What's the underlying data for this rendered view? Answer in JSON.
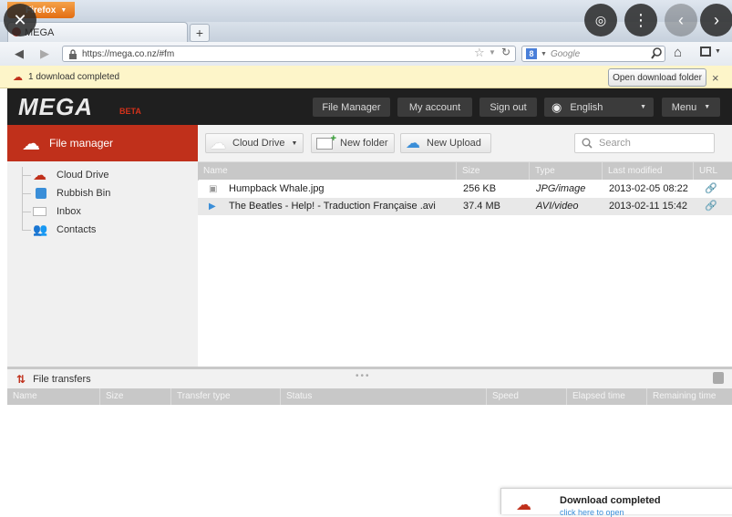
{
  "browser": {
    "app_button": "Firefox",
    "tab_title": "MEGA",
    "new_tab": "+",
    "url": "https://mega.co.nz/#fm",
    "search_engine_placeholder": "Google"
  },
  "notification": {
    "text": "1 download completed",
    "button": "Open download folder",
    "close": "×"
  },
  "mega_header": {
    "logo": "MEGA",
    "beta": "BETA",
    "buttons": [
      "File Manager",
      "My account",
      "Sign out"
    ],
    "language": "English",
    "menu": "Menu"
  },
  "sidebar": {
    "title": "File manager",
    "items": [
      "Cloud Drive",
      "Rubbish Bin",
      "Inbox",
      "Contacts"
    ]
  },
  "toolbar": {
    "cloud_drive": "Cloud Drive",
    "new_folder": "New folder",
    "new_upload": "New Upload",
    "search_placeholder": "Search"
  },
  "file_table": {
    "columns": [
      "Name",
      "Size",
      "Type",
      "Last modified",
      "URL"
    ],
    "rows": [
      {
        "name": "Humpback Whale.jpg",
        "size": "256 KB",
        "type": "JPG/image",
        "modified": "2013-02-05 08:22"
      },
      {
        "name": "The Beatles - Help! - Traduction Française .avi",
        "size": "37.4 MB",
        "type": "AVI/video",
        "modified": "2013-02-11 15:42"
      }
    ]
  },
  "transfers": {
    "title": "File transfers",
    "columns": [
      "Name",
      "Size",
      "Transfer type",
      "Status",
      "Speed",
      "Elapsed time",
      "Remaining time"
    ]
  },
  "popup": {
    "title": "Download completed",
    "subtitle": "click here to open"
  },
  "colors": {
    "mega_red": "#c0301b",
    "header_dark": "#1f1f1f",
    "notification_bg": "#fdf5c9"
  }
}
